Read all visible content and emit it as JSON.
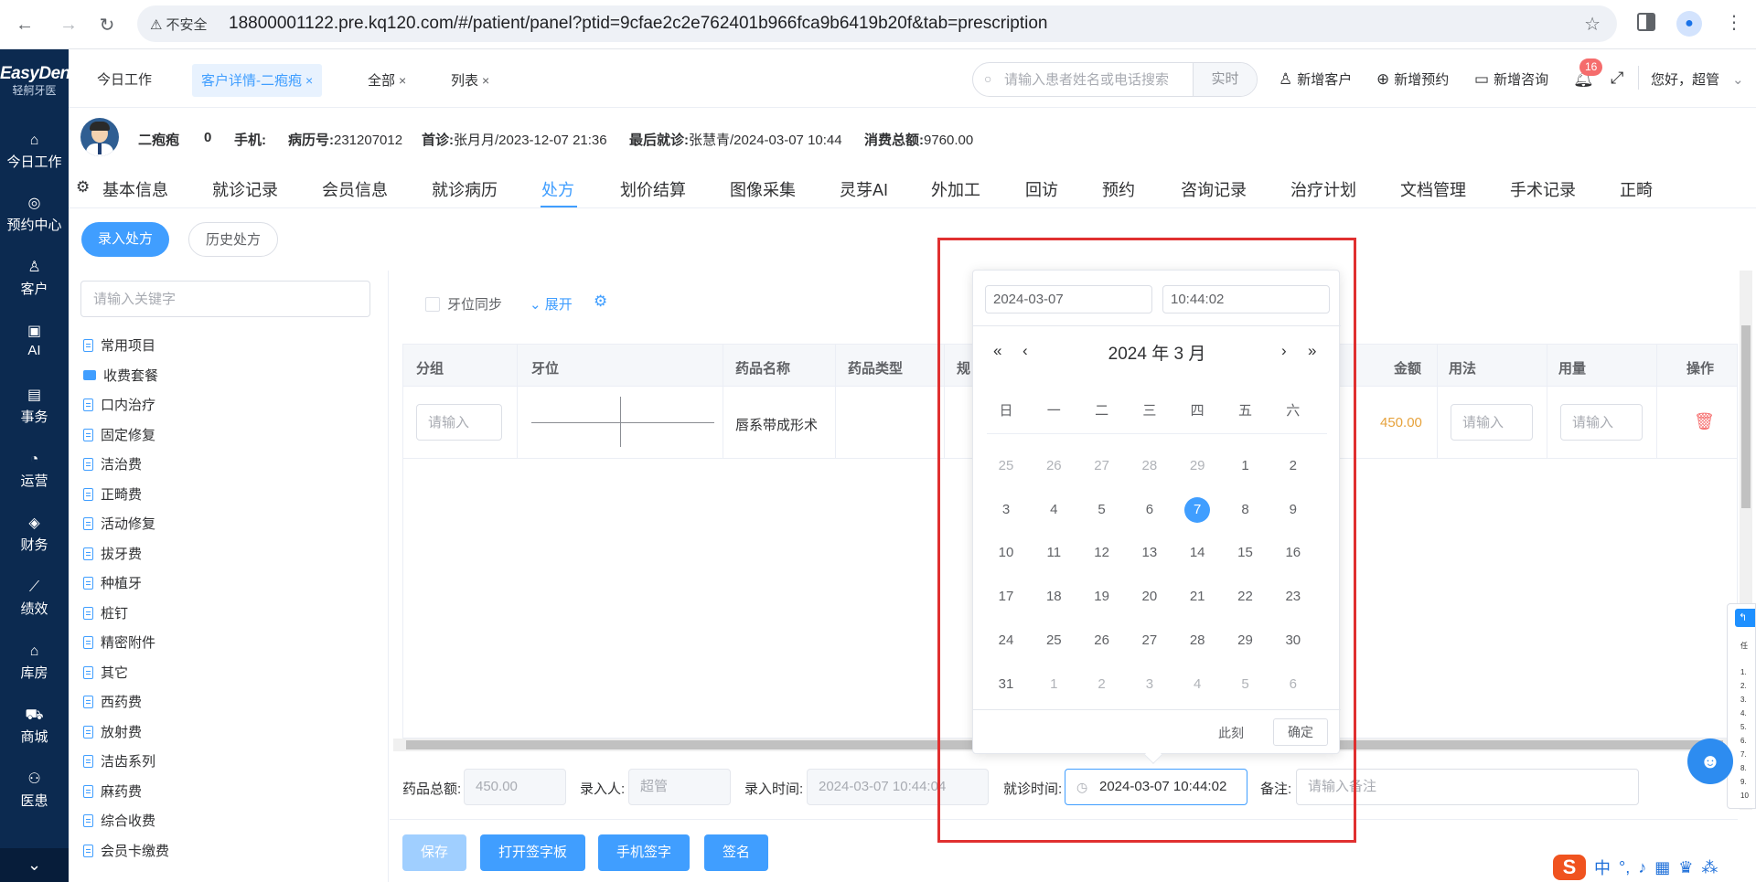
{
  "browser": {
    "insecure_label": "不安全",
    "url": "18800001122.pre.kq120.com/#/patient/panel?ptid=9cfae2c2e762401b966fca9b6419b20f&tab=prescription"
  },
  "sidebar": {
    "logo_text": "EasyDent",
    "logo_sub": "轻舸牙医",
    "items": [
      {
        "label": "今日工作",
        "icon": "home-icon"
      },
      {
        "label": "预约中心",
        "icon": "calendar-icon"
      },
      {
        "label": "客户",
        "icon": "user-icon"
      },
      {
        "label": "AI",
        "icon": "ai-icon"
      },
      {
        "label": "事务",
        "icon": "task-icon"
      },
      {
        "label": "运营",
        "icon": "clock-icon"
      },
      {
        "label": "财务",
        "icon": "finance-icon"
      },
      {
        "label": "绩效",
        "icon": "chart-icon"
      },
      {
        "label": "库房",
        "icon": "warehouse-icon"
      },
      {
        "label": "商城",
        "icon": "cart-icon"
      },
      {
        "label": "医患",
        "icon": "people-icon"
      }
    ]
  },
  "topbar": {
    "tabs": [
      {
        "label": "今日工作",
        "closable": false
      },
      {
        "label": "客户详情-二疱疱",
        "closable": true,
        "active": true
      },
      {
        "label": "全部",
        "closable": true
      },
      {
        "label": "列表",
        "closable": true
      }
    ],
    "close_glyph": "×",
    "search_placeholder": "请输入患者姓名或电话搜索",
    "search_mode": "实时",
    "actions": [
      "新增客户",
      "新增预约",
      "新增咨询"
    ],
    "notification_count": "16",
    "greeting": "您好，超管"
  },
  "patient": {
    "name": "二疱疱",
    "age": "0",
    "phone_label": "手机:",
    "record_label": "病历号:",
    "record_no": "231207012",
    "first_visit_label": "首诊:",
    "first_visit": "张月月/2023-12-07 21:36",
    "last_visit_label": "最后就诊:",
    "last_visit": "张慧青/2024-03-07 10:44",
    "total_label": "消费总额:",
    "total": "9760.00"
  },
  "module_tabs": [
    "基本信息",
    "就诊记录",
    "会员信息",
    "就诊病历",
    "处方",
    "划价结算",
    "图像采集",
    "灵芽AI",
    "外加工",
    "回访",
    "预约",
    "咨询记录",
    "治疗计划",
    "文档管理",
    "手术记录",
    "正畸"
  ],
  "module_active": "处方",
  "sub_actions": {
    "enter": "录入处方",
    "history": "历史处方"
  },
  "left_panel": {
    "keyword_placeholder": "请输入关键字",
    "categories": [
      "常用项目",
      "收费套餐",
      "口内治疗",
      "固定修复",
      "洁治费",
      "正畸费",
      "活动修复",
      "拔牙费",
      "种植牙",
      "桩钉",
      "精密附件",
      "其它",
      "西药费",
      "放射费",
      "洁齿系列",
      "麻药费",
      "综合收费",
      "会员卡缴费"
    ]
  },
  "main": {
    "tooth_sync": "牙位同步",
    "expand": "展开",
    "columns": [
      "分组",
      "牙位",
      "药品名称",
      "药品类型",
      "规",
      "金额",
      "用法",
      "用量",
      "操作"
    ],
    "row": {
      "group_placeholder": "请输入",
      "drug_name": "唇系带成形术",
      "amount": "450.00",
      "usage_placeholder": "请输入",
      "dosage_placeholder": "请输入"
    }
  },
  "footer": {
    "drug_total_label": "药品总额:",
    "drug_total": "450.00",
    "entered_by_label": "录入人:",
    "entered_by": "超管",
    "entry_time_label": "录入时间:",
    "entry_time": "2024-03-07 10:44:04",
    "visit_time_label": "就诊时间:",
    "visit_time": "2024-03-07 10:44:02",
    "remark_label": "备注:",
    "remark_placeholder": "请输入备注",
    "buttons": [
      "保存",
      "打开签字板",
      "手机签字",
      "签名"
    ]
  },
  "datepicker": {
    "date_value": "2024-03-07",
    "time_value": "10:44:02",
    "title": "2024 年  3 月",
    "prev_year": "«",
    "prev_month": "‹",
    "next_month": "›",
    "next_year": "»",
    "weekdays": [
      "日",
      "一",
      "二",
      "三",
      "四",
      "五",
      "六"
    ],
    "weeks": [
      [
        "25",
        "26",
        "27",
        "28",
        "29",
        "1",
        "2"
      ],
      [
        "3",
        "4",
        "5",
        "6",
        "7",
        "8",
        "9"
      ],
      [
        "10",
        "11",
        "12",
        "13",
        "14",
        "15",
        "16"
      ],
      [
        "17",
        "18",
        "19",
        "20",
        "21",
        "22",
        "23"
      ],
      [
        "24",
        "25",
        "26",
        "27",
        "28",
        "29",
        "30"
      ],
      [
        "31",
        "1",
        "2",
        "3",
        "4",
        "5",
        "6"
      ]
    ],
    "selected": "7",
    "now_label": "此刻",
    "ok_label": "确定"
  },
  "colors": {
    "primary": "#409eff",
    "sidebar": "#0c2a50",
    "amount": "#e6a23c",
    "danger": "#f56c6c",
    "annotation": "#e03030"
  }
}
